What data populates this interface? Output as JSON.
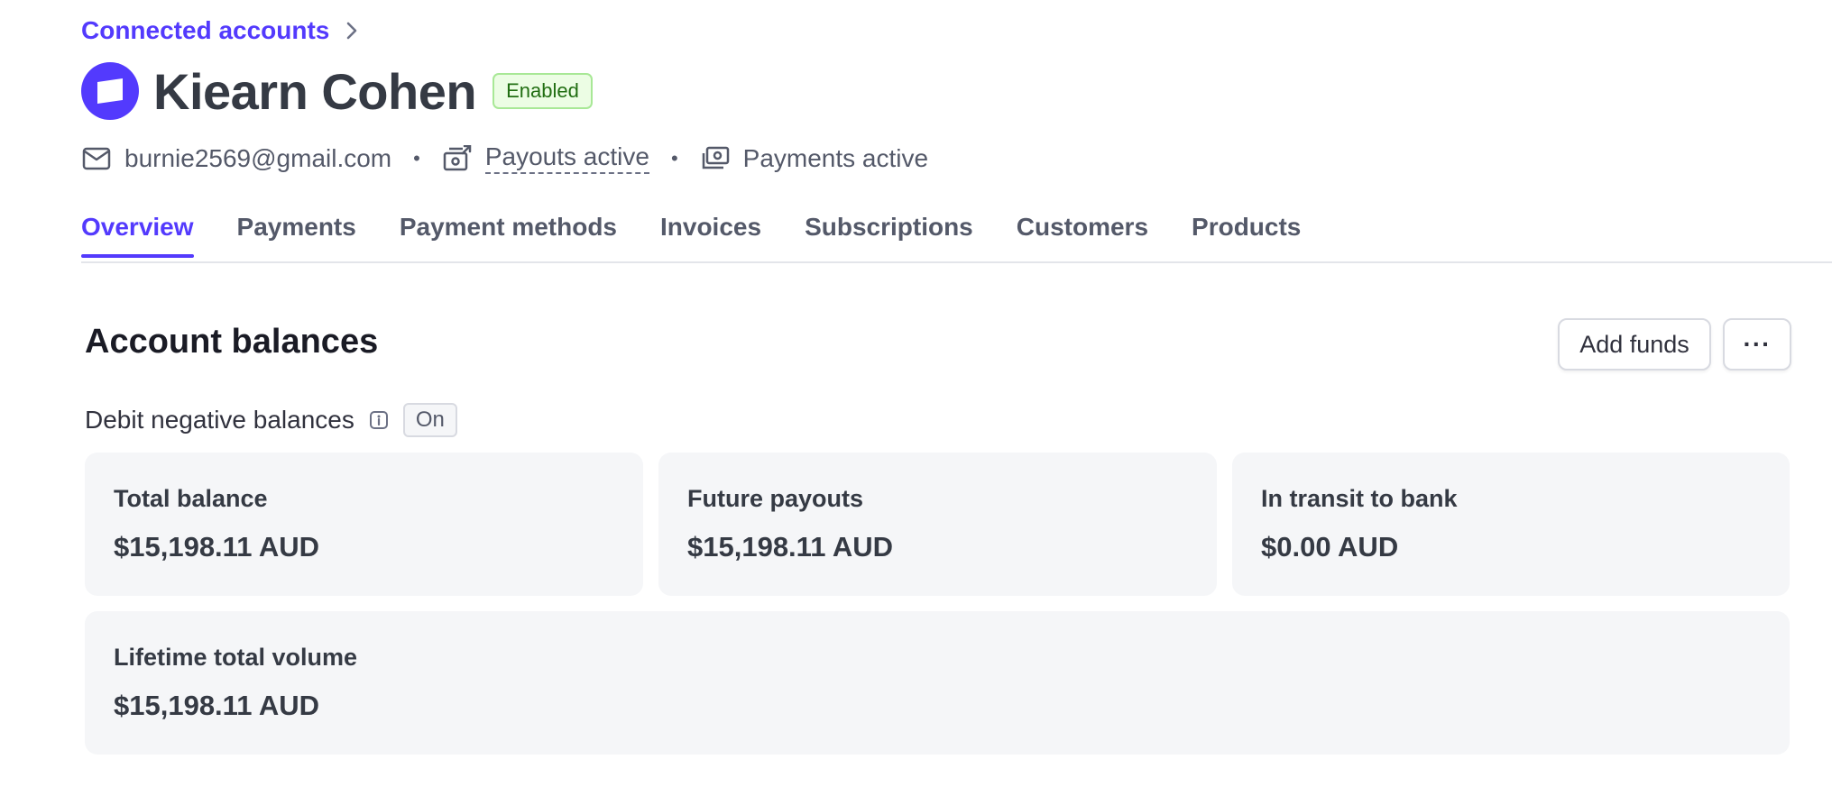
{
  "breadcrumb": {
    "label": "Connected accounts"
  },
  "account": {
    "name": "Kiearn Cohen",
    "status_badge": "Enabled",
    "email": "burnie2569@gmail.com",
    "payouts_status": "Payouts active",
    "payments_status": "Payments active"
  },
  "tabs": [
    {
      "label": "Overview",
      "active": true
    },
    {
      "label": "Payments"
    },
    {
      "label": "Payment methods"
    },
    {
      "label": "Invoices"
    },
    {
      "label": "Subscriptions"
    },
    {
      "label": "Customers"
    },
    {
      "label": "Products"
    }
  ],
  "balances": {
    "title": "Account balances",
    "add_funds_label": "Add funds",
    "more_label": "···",
    "debit_label": "Debit negative balances",
    "debit_value": "On",
    "cards": [
      {
        "label": "Total balance",
        "value": "$15,198.11 AUD"
      },
      {
        "label": "Future payouts",
        "value": "$15,198.11 AUD"
      },
      {
        "label": "In transit to bank",
        "value": "$0.00 AUD"
      },
      {
        "label": "Lifetime total volume",
        "value": "$15,198.11 AUD"
      }
    ]
  },
  "colors": {
    "accent": "#533afd",
    "badge_bg": "#ecfde4",
    "badge_text": "#216e12",
    "card_bg": "#f5f6f8"
  },
  "icons": {
    "breadcrumb": "chevron-right-icon",
    "avatar": "account-avatar-icon",
    "email": "envelope-icon",
    "payouts": "payout-icon",
    "payments": "payment-icon",
    "info": "info-icon"
  }
}
